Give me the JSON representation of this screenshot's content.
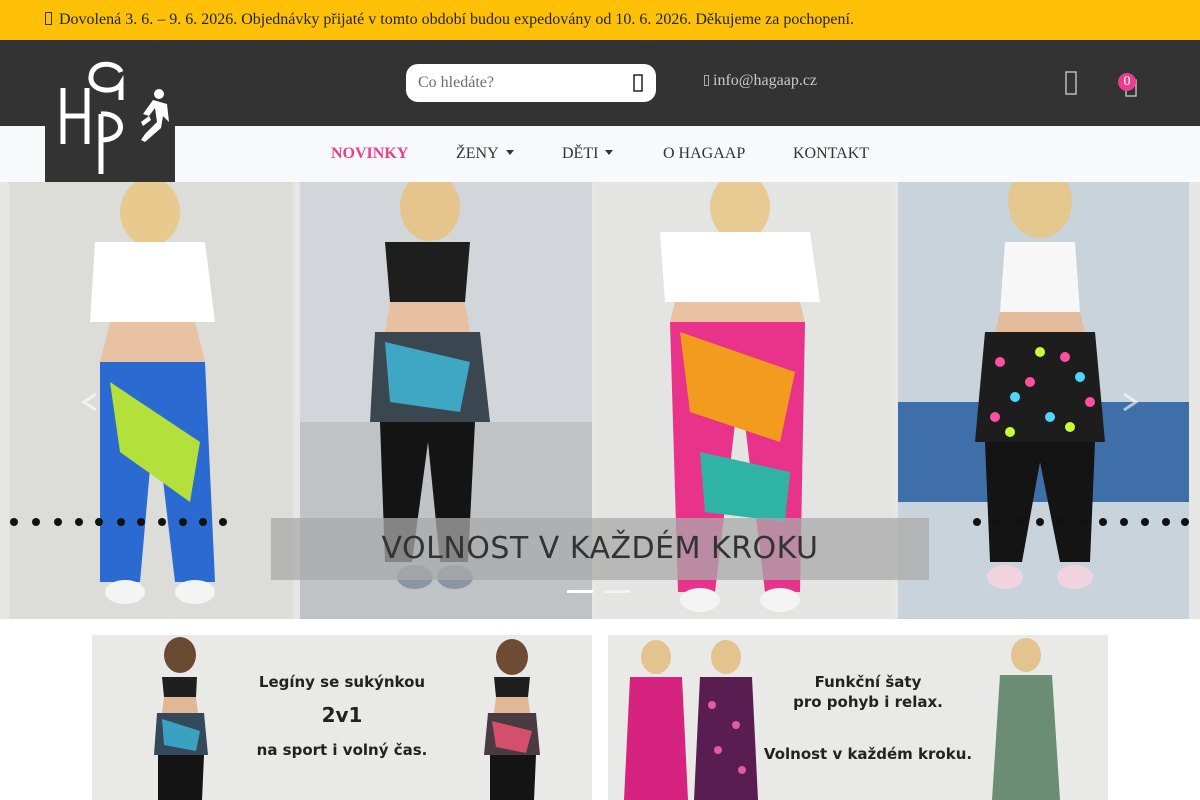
{
  "notice": {
    "text": "Dovolená 3. 6. – 9. 6. 2026. Objednávky přijaté v tomto období budou expedovány od 10. 6. 2026. Děkujeme za pochopení.",
    "background": "#ffc107"
  },
  "header": {
    "search": {
      "placeholder": "Co hledáte?"
    },
    "email": "info@hagaap.cz",
    "cart_count": "0",
    "background": "#333333"
  },
  "logo": {
    "alt": "HAGAAP"
  },
  "nav": {
    "items": [
      {
        "label": "NOVINKY",
        "active": true
      },
      {
        "label": "ŽENY",
        "dropdown": true
      },
      {
        "label": "DĚTI",
        "dropdown": true
      },
      {
        "label": "O HAGAAP"
      },
      {
        "label": "KONTAKT"
      }
    ],
    "accent": "#e83e8c"
  },
  "carousel": {
    "caption": "VOLNOST V KAŽDÉM KROKU",
    "slide_count": 2,
    "active_index": 0
  },
  "promos": [
    {
      "line1": "Legíny se sukýnkou",
      "line2": "2v1",
      "line3": "na sport i volný čas."
    },
    {
      "line1": "Funkční šaty",
      "line2": "pro pohyb i relax.",
      "line3": "Volnost v každém kroku."
    }
  ]
}
